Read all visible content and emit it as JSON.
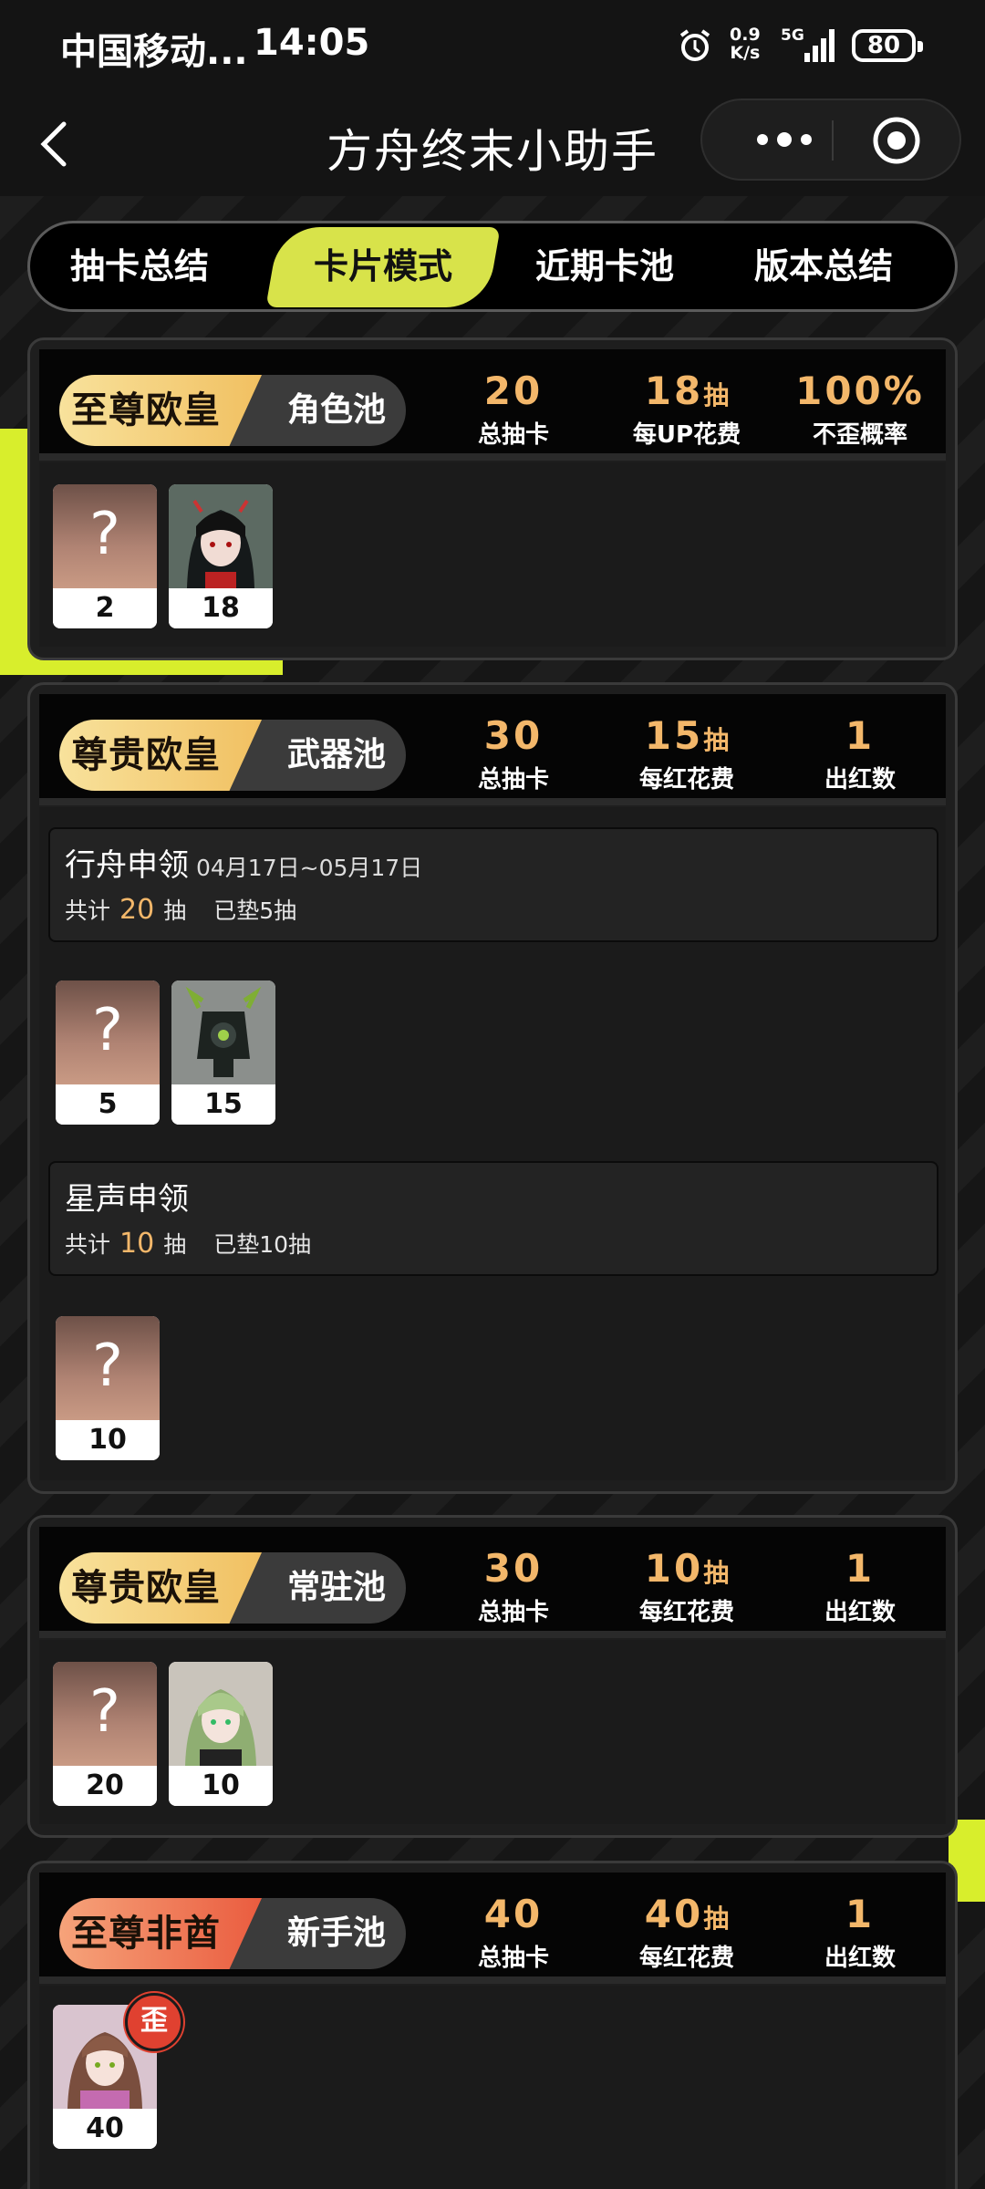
{
  "status_bar": {
    "carrier": "中国移动...",
    "time": "14:05",
    "net_speed_value": "0.9",
    "net_speed_unit": "K/s",
    "network": "5G",
    "battery": "80"
  },
  "nav": {
    "title": "方舟终末小助手"
  },
  "tabs": [
    {
      "label": "抽卡总结"
    },
    {
      "label": "卡片模式",
      "active": true
    },
    {
      "label": "近期卡池"
    },
    {
      "label": "版本总结"
    }
  ],
  "pools": [
    {
      "rank": "至尊欧皇",
      "type": "角色池",
      "stats": [
        {
          "value": "20",
          "unit": "",
          "label": "总抽卡"
        },
        {
          "value": "18",
          "unit": "抽",
          "label": "每UP花费"
        },
        {
          "value": "100%",
          "unit": "",
          "label": "不歪概率"
        }
      ],
      "cards": [
        {
          "kind": "unknown",
          "glyph": "?",
          "count": "2"
        },
        {
          "kind": "character",
          "count": "18"
        }
      ]
    },
    {
      "rank": "尊贵欧皇",
      "type": "武器池",
      "stats": [
        {
          "value": "30",
          "unit": "",
          "label": "总抽卡"
        },
        {
          "value": "15",
          "unit": "抽",
          "label": "每红花费"
        },
        {
          "value": "1",
          "unit": "",
          "label": "出红数"
        }
      ],
      "banners": [
        {
          "name": "行舟申领",
          "date": "04月17日~05月17日",
          "total_prefix": "共计",
          "total": "20",
          "total_suffix": "抽",
          "pity": "已垫5抽",
          "cards": [
            {
              "kind": "unknown",
              "glyph": "?",
              "count": "5"
            },
            {
              "kind": "weapon",
              "count": "15"
            }
          ]
        },
        {
          "name": "星声申领",
          "date": "",
          "total_prefix": "共计",
          "total": "10",
          "total_suffix": "抽",
          "pity": "已垫10抽",
          "cards": [
            {
              "kind": "unknown",
              "glyph": "?",
              "count": "10"
            }
          ]
        }
      ]
    },
    {
      "rank": "尊贵欧皇",
      "type": "常驻池",
      "stats": [
        {
          "value": "30",
          "unit": "",
          "label": "总抽卡"
        },
        {
          "value": "10",
          "unit": "抽",
          "label": "每红花费"
        },
        {
          "value": "1",
          "unit": "",
          "label": "出红数"
        }
      ],
      "cards": [
        {
          "kind": "unknown",
          "glyph": "?",
          "count": "20"
        },
        {
          "kind": "character",
          "count": "10"
        }
      ]
    },
    {
      "rank": "至尊非酋",
      "type": "新手池",
      "stats": [
        {
          "value": "40",
          "unit": "",
          "label": "总抽卡"
        },
        {
          "value": "40",
          "unit": "抽",
          "label": "每红花费"
        },
        {
          "value": "1",
          "unit": "",
          "label": "出红数"
        }
      ],
      "cards": [
        {
          "kind": "character",
          "count": "40",
          "badge": "歪"
        }
      ]
    }
  ],
  "colors": {
    "accent_lime": "#d8e34a",
    "stat_orange": "#f3b76a",
    "rank_gold": "#f1c061",
    "rank_red": "#ea5c3f"
  }
}
